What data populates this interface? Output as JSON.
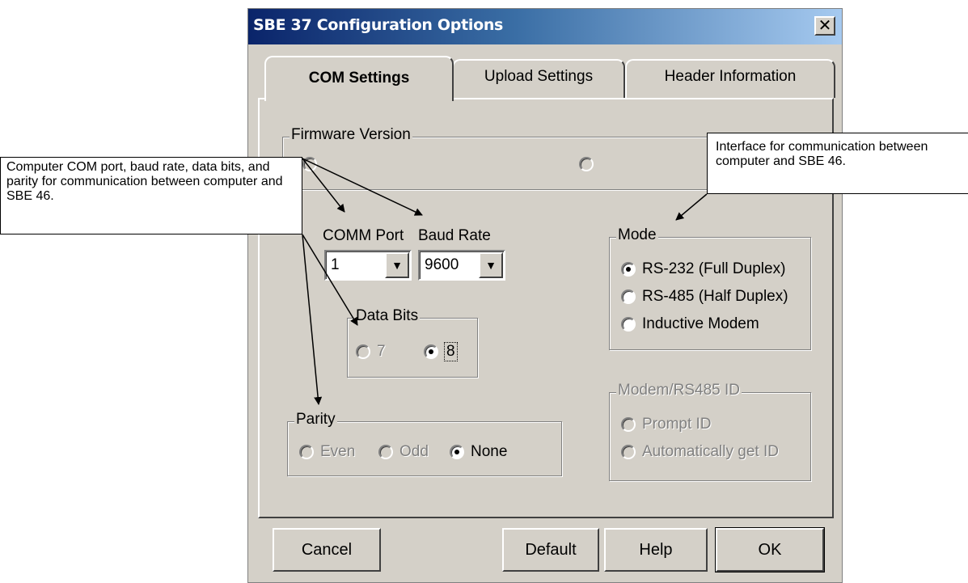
{
  "window": {
    "title": "SBE 37 Configuration Options",
    "close_glyph": "✕"
  },
  "tabs": [
    {
      "label": "COM Settings",
      "selected": true
    },
    {
      "label": "Upload Settings",
      "selected": false
    },
    {
      "label": "Header Information",
      "selected": false
    }
  ],
  "firmware": {
    "legend": "Firmware Version",
    "options": [
      {
        "label": "",
        "selected": false
      },
      {
        "label": "",
        "selected": false
      }
    ]
  },
  "comm_port": {
    "label": "COMM Port",
    "value": "1"
  },
  "baud_rate": {
    "label": "Baud Rate",
    "value": "9600"
  },
  "data_bits": {
    "legend": "Data Bits",
    "options": [
      {
        "label": "7",
        "selected": false,
        "enabled": false
      },
      {
        "label": "8",
        "selected": true,
        "enabled": true
      }
    ]
  },
  "parity": {
    "legend": "Parity",
    "options": [
      {
        "label": "Even",
        "selected": false,
        "enabled": false
      },
      {
        "label": "Odd",
        "selected": false,
        "enabled": false
      },
      {
        "label": "None",
        "selected": true,
        "enabled": true
      }
    ]
  },
  "mode": {
    "legend": "Mode",
    "options": [
      {
        "label": "RS-232 (Full Duplex)",
        "selected": true
      },
      {
        "label": "RS-485 (Half Duplex)",
        "selected": false
      },
      {
        "label": "Inductive Modem",
        "selected": false
      }
    ]
  },
  "modem_id": {
    "legend": "Modem/RS485 ID",
    "options": [
      {
        "label": "Prompt ID",
        "selected": false,
        "enabled": false
      },
      {
        "label": "Automatically get ID",
        "selected": false,
        "enabled": false
      }
    ]
  },
  "buttons": {
    "cancel": "Cancel",
    "default": "Default",
    "help": "Help",
    "ok": "OK"
  },
  "callouts": {
    "left": "Computer COM port, baud rate, data bits, and parity for communication between computer and SBE 46.",
    "right": "Interface for communication between computer and SBE 46."
  },
  "colors": {
    "titlebar_start": "#0a246a",
    "titlebar_end": "#a6caf0",
    "face": "#d4d0c8"
  },
  "icons": {
    "dropdown": "▼",
    "close": "close-icon"
  }
}
